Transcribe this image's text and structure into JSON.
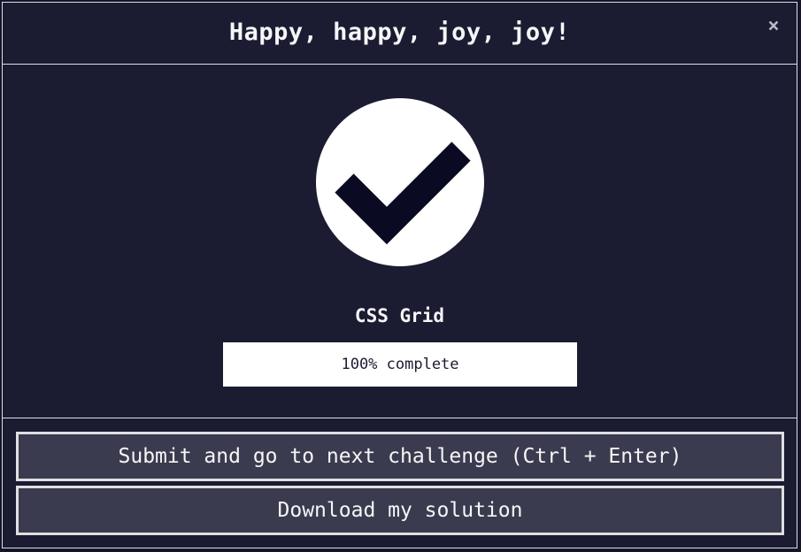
{
  "modal": {
    "title": "Happy, happy, joy, joy!",
    "close_symbol": "×",
    "close_icon": "close-icon"
  },
  "completion": {
    "icon": "checkmark-icon",
    "block_title": "CSS Grid",
    "progress_percent": 100,
    "progress_text": "100% complete"
  },
  "actions": {
    "submit_label": "Submit and go to next challenge (Ctrl + Enter)",
    "download_label": "Download my solution"
  },
  "colors": {
    "background": "#1b1b32",
    "button_bg": "#3b3b4f",
    "border": "#dfdfe2",
    "text": "#f5f6f7",
    "check_mark": "#0a0a23"
  }
}
